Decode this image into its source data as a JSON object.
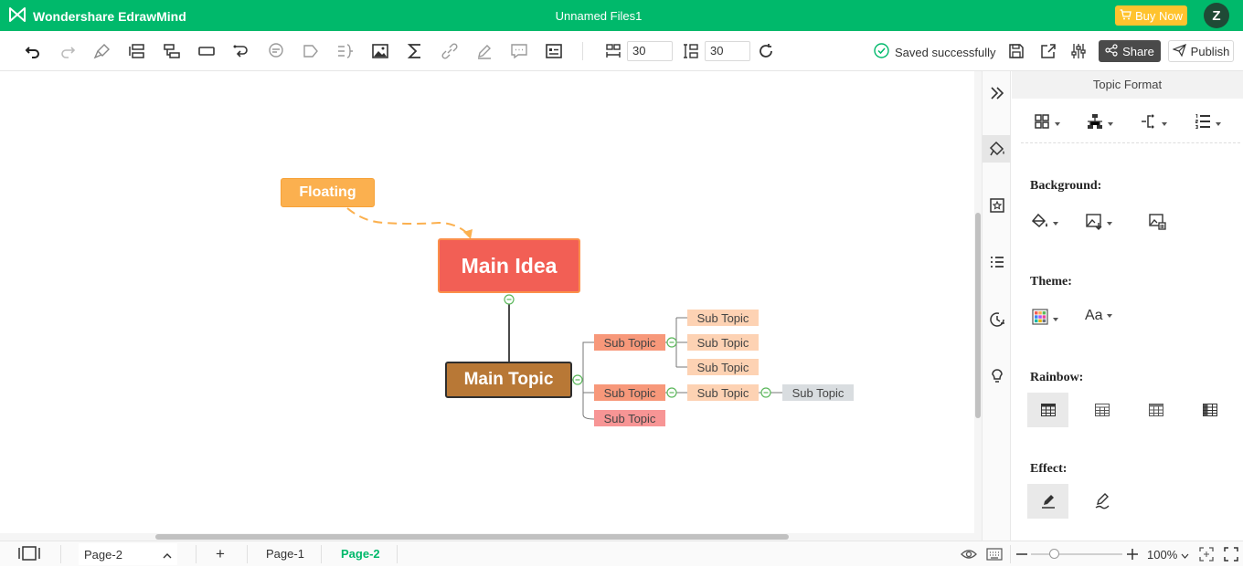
{
  "titlebar": {
    "brand": "Wondershare EdrawMind",
    "doc_title": "Unnamed Files1",
    "buy_label": "Buy Now",
    "avatar_letter": "Z"
  },
  "toolbar": {
    "icons": [
      "undo-icon",
      "redo-icon",
      "format-painter-icon",
      "topic-icon",
      "subtopic-icon",
      "floating-topic-icon",
      "relationship-icon",
      "callout-icon",
      "boundary-icon",
      "summary-icon",
      "image-icon",
      "formula-icon",
      "hyperlink-icon",
      "note-icon",
      "comment-icon",
      "outline-icon"
    ],
    "h_spacing": "30",
    "v_spacing": "30",
    "saved_text": "Saved successfully",
    "share_label": "Share",
    "publish_label": "Publish"
  },
  "mindmap": {
    "floating": "Floating",
    "main_idea": "Main Idea",
    "main_topic": "Main Topic",
    "sub_topic_1": "Sub Topic",
    "sub_topic_2": "Sub Topic",
    "sub_topic_3": "Sub Topic",
    "sub_1_1": "Sub Topic",
    "sub_1_2": "Sub Topic",
    "sub_1_3": "Sub Topic",
    "sub_2_1": "Sub Topic",
    "sub_2_1_1": "Sub Topic"
  },
  "panel": {
    "title": "Topic Format",
    "background_label": "Background:",
    "theme_label": "Theme:",
    "rainbow_label": "Rainbow:",
    "effect_label": "Effect:",
    "font_icon_text": "Aa"
  },
  "statusbar": {
    "page_select": "Page-2",
    "add": "+",
    "tabs": [
      "Page-1",
      "Page-2"
    ],
    "active_tab": "Page-2",
    "zoom": "100%"
  },
  "colors": {
    "accent": "#00b96b",
    "buy": "#ffc32e",
    "main_idea": "#f25f55",
    "main_topic": "#b87836",
    "floating": "#fbb04f",
    "sub_level1": "#f7987a",
    "sub_level2": "#fdd2b3",
    "sub_level3": "#d9dde0"
  }
}
